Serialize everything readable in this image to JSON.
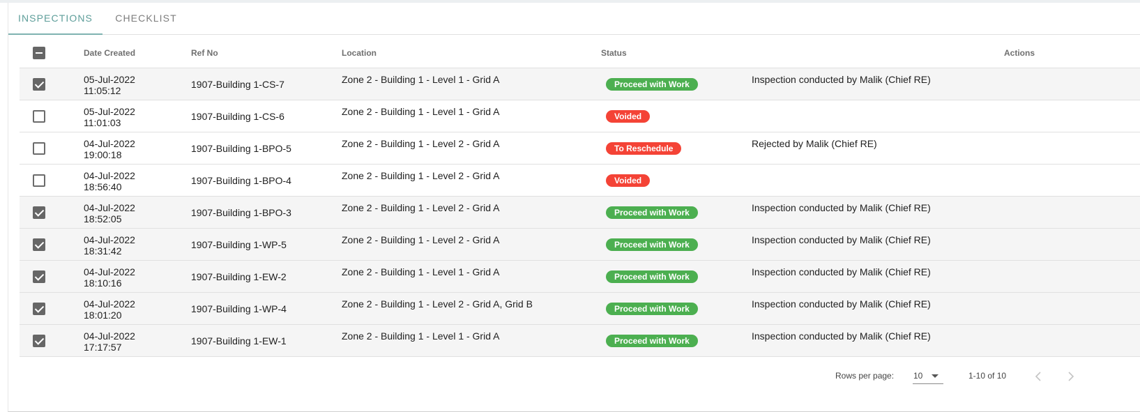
{
  "tabs": [
    {
      "label": "INSPECTIONS",
      "active": true
    },
    {
      "label": "CHECKLIST",
      "active": false
    }
  ],
  "table": {
    "headers": {
      "date_created": "Date Created",
      "ref_no": "Ref No",
      "location": "Location",
      "status": "Status",
      "actions": "Actions"
    },
    "select_all_state": "indeterminate",
    "rows": [
      {
        "checked": true,
        "date": "05-Jul-2022",
        "time": "11:05:12",
        "ref": "1907-Building 1-CS-7",
        "location": "Zone 2 - Building 1 - Level 1 - Grid A",
        "status": "Proceed with Work",
        "status_color": "#4caf50",
        "remark": "Inspection conducted by Malik (Chief RE)"
      },
      {
        "checked": false,
        "date": "05-Jul-2022",
        "time": "11:01:03",
        "ref": "1907-Building 1-CS-6",
        "location": "Zone 2 - Building 1 - Level 1 - Grid A",
        "status": "Voided",
        "status_color": "#f44336",
        "remark": ""
      },
      {
        "checked": false,
        "date": "04-Jul-2022",
        "time": "19:00:18",
        "ref": "1907-Building 1-BPO-5",
        "location": "Zone 2 - Building 1 - Level 2 - Grid A",
        "status": "To Reschedule",
        "status_color": "#f44336",
        "remark": "Rejected by Malik (Chief RE)"
      },
      {
        "checked": false,
        "date": "04-Jul-2022",
        "time": "18:56:40",
        "ref": "1907-Building 1-BPO-4",
        "location": "Zone 2 - Building 1 - Level 2 - Grid A",
        "status": "Voided",
        "status_color": "#f44336",
        "remark": ""
      },
      {
        "checked": true,
        "date": "04-Jul-2022",
        "time": "18:52:05",
        "ref": "1907-Building 1-BPO-3",
        "location": "Zone 2 - Building 1 - Level 2 - Grid A",
        "status": "Proceed with Work",
        "status_color": "#4caf50",
        "remark": "Inspection conducted by Malik (Chief RE)"
      },
      {
        "checked": true,
        "date": "04-Jul-2022",
        "time": "18:31:42",
        "ref": "1907-Building 1-WP-5",
        "location": "Zone 2 - Building 1 - Level 2 - Grid A",
        "status": "Proceed with Work",
        "status_color": "#4caf50",
        "remark": "Inspection conducted by Malik (Chief RE)"
      },
      {
        "checked": true,
        "date": "04-Jul-2022",
        "time": "18:10:16",
        "ref": "1907-Building 1-EW-2",
        "location": "Zone 2 - Building 1 - Level 1 - Grid A",
        "status": "Proceed with Work",
        "status_color": "#4caf50",
        "remark": "Inspection conducted by Malik (Chief RE)"
      },
      {
        "checked": true,
        "date": "04-Jul-2022",
        "time": "18:01:20",
        "ref": "1907-Building 1-WP-4",
        "location": "Zone 2 - Building 1 - Level 2 - Grid A, Grid B",
        "status": "Proceed with Work",
        "status_color": "#4caf50",
        "remark": "Inspection conducted by Malik (Chief RE)"
      },
      {
        "checked": true,
        "date": "04-Jul-2022",
        "time": "17:17:57",
        "ref": "1907-Building 1-EW-1",
        "location": "Zone 2 - Building 1 - Level 1 - Grid A",
        "status": "Proceed with Work",
        "status_color": "#4caf50",
        "remark": "Inspection conducted by Malik (Chief RE)"
      }
    ]
  },
  "pagination": {
    "rows_per_page_label": "Rows per page:",
    "rows_per_page": "10",
    "range": "1-10 of 10",
    "prev_icon": "chevron-left-icon",
    "next_icon": "chevron-right-icon"
  }
}
